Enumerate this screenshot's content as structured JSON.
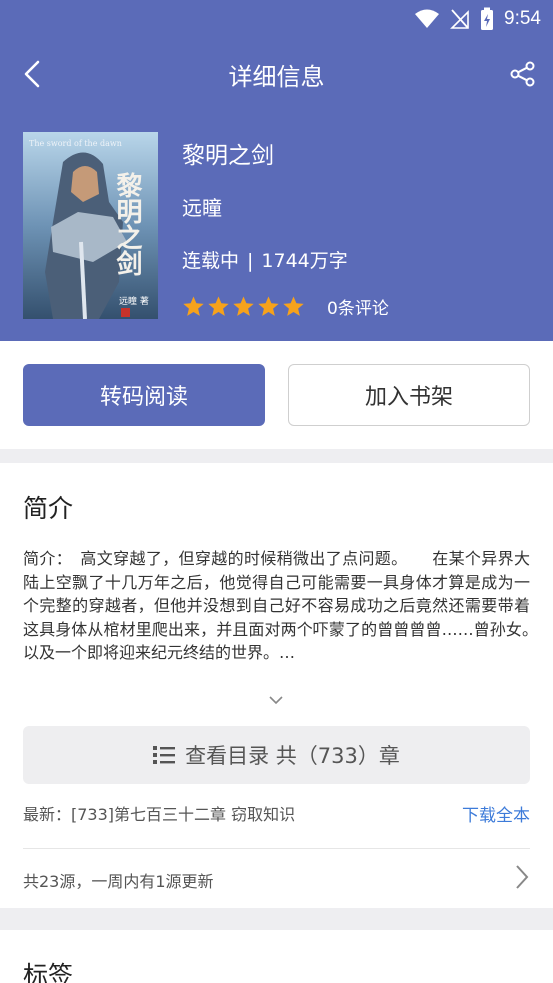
{
  "status_bar": {
    "time": "9:54"
  },
  "app_bar": {
    "title": "详细信息"
  },
  "book": {
    "title": "黎明之剑",
    "author": "远瞳",
    "serial_status": "连载中",
    "separator": "|",
    "word_count": "1744万字",
    "rating_stars": 5,
    "review_count": "0条评论",
    "cover_text_en": "The sword of the dawn",
    "cover_title_cn": "黎明之剑",
    "cover_author_mark": "远瞳 著"
  },
  "actions": {
    "read_label": "转码阅读",
    "shelf_label": "加入书架"
  },
  "intro": {
    "heading": "简介",
    "text": "简介：　高文穿越了，但穿越的时候稍微出了点问题。　　在某个异界大陆上空飘了十几万年之后，他觉得自己可能需要一具身体才算是成为一个完整的穿越者，但他并没想到自己好不容易成功之后竟然还需要带着这具身体从棺材里爬出来，并且面对两个吓蒙了的曾曾曾曾……曾孙女。　　以及一个即将迎来纪元终结的世界。…",
    "toc_label": "查看目录 共（733）章",
    "latest_chapter": "最新：[733]第七百三十二章 窃取知识",
    "download_label": "下载全本",
    "sources_text": "共23源，一周内有1源更新"
  },
  "tags": {
    "heading": "标签"
  },
  "colors": {
    "primary": "#5b6bb8",
    "star": "#f7a21b",
    "link": "#3d7bd9"
  }
}
